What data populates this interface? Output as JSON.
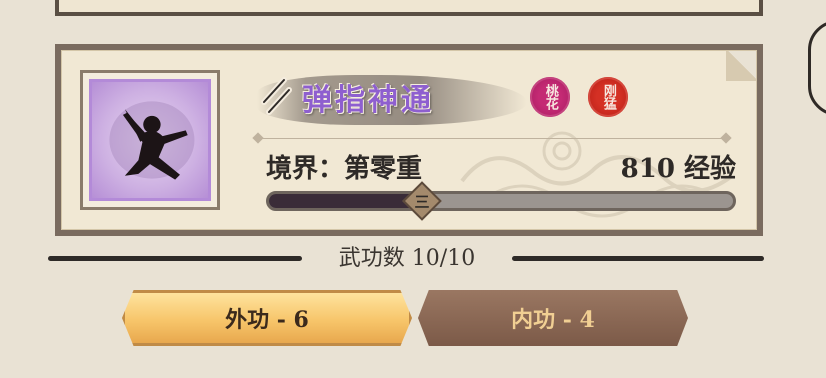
{
  "skill": {
    "name": "弹指神通",
    "tags": [
      "桃花",
      "刚猛"
    ],
    "realm": "境界：第零重",
    "exp": "810 经验",
    "progress_fraction": 0.33,
    "progress_marker": "三"
  },
  "martial_count": "武功数 10/10",
  "tabs": [
    {
      "label": "外功 - 6",
      "active": true
    },
    {
      "label": "内功 - 4",
      "active": false
    }
  ],
  "colors": {
    "skill_name": "#8e5fcf",
    "active_tab": "#f7c56a",
    "inactive_tab": "#7c5a48",
    "seal_peach": "#c42a74",
    "seal_strong": "#d43024"
  }
}
